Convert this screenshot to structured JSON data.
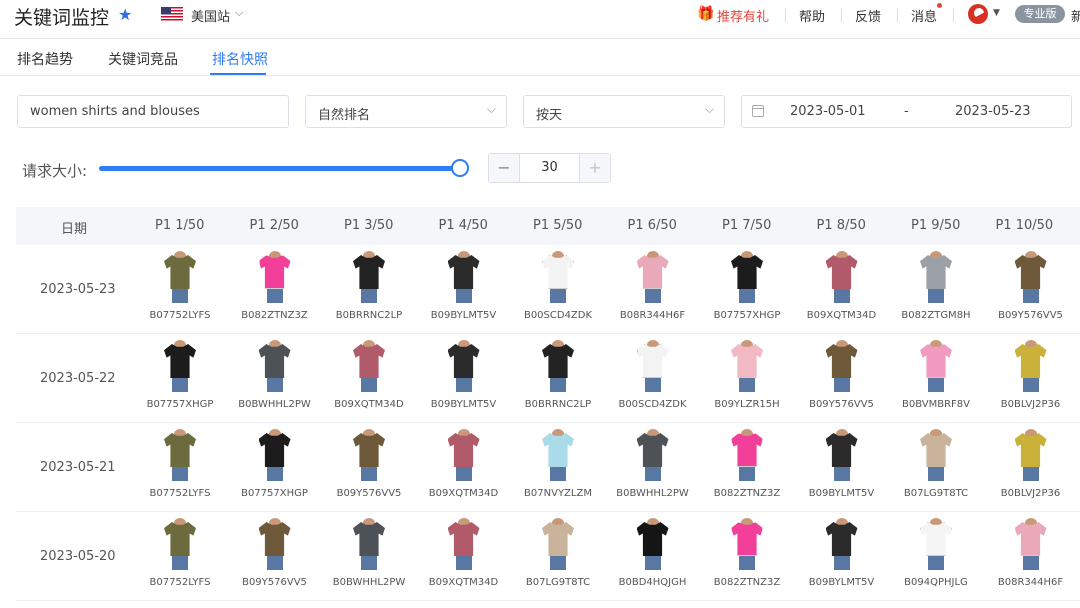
{
  "header": {
    "title": "关键词监控",
    "site": "美国站",
    "recommend": "推荐有礼",
    "help": "帮助",
    "feedback": "反馈",
    "messages": "消息",
    "plan": "专业版",
    "user_trunc": "新",
    "accent_color": "#2f7cf6",
    "alert_color": "#e2453c"
  },
  "tabs": [
    {
      "label": "排名趋势",
      "active": false
    },
    {
      "label": "关键词竞品",
      "active": false
    },
    {
      "label": "排名快照",
      "active": true
    }
  ],
  "filters": {
    "keyword": "women shirts and blouses",
    "rank_type": "自然排名",
    "granularity": "按天",
    "date_start": "2023-05-01",
    "date_sep": "-",
    "date_end": "2023-05-23"
  },
  "request_size": {
    "label": "请求大小:",
    "value": "30",
    "slider_fraction": 1.0
  },
  "table": {
    "date_header": "日期",
    "columns": [
      "P1 1/50",
      "P1 2/50",
      "P1 3/50",
      "P1 4/50",
      "P1 5/50",
      "P1 6/50",
      "P1 7/50",
      "P1 8/50",
      "P1 9/50",
      "P1 10/50"
    ],
    "rows": [
      {
        "date": "2023-05-23",
        "items": [
          {
            "asin": "B07752LYFS",
            "color": "#6b6b3d"
          },
          {
            "asin": "B082ZTNZ3Z",
            "color": "#f2409a"
          },
          {
            "asin": "B0BRRNC2LP",
            "color": "#222222"
          },
          {
            "asin": "B09BYLMT5V",
            "color": "#2b2b2b"
          },
          {
            "asin": "B00SCD4ZDK",
            "color": "#f3f3f3"
          },
          {
            "asin": "B08R344H6F",
            "color": "#e9a9b8"
          },
          {
            "asin": "B07757XHGP",
            "color": "#1c1c1c"
          },
          {
            "asin": "B09XQTM34D",
            "color": "#b05a6a"
          },
          {
            "asin": "B082ZTGM8H",
            "color": "#9aa0a6"
          },
          {
            "asin": "B09Y576VV5",
            "color": "#6e5a3a"
          }
        ]
      },
      {
        "date": "2023-05-22",
        "items": [
          {
            "asin": "B07757XHGP",
            "color": "#1c1c1c"
          },
          {
            "asin": "B0BWHHL2PW",
            "color": "#4d5257"
          },
          {
            "asin": "B09XQTM34D",
            "color": "#b05a6a"
          },
          {
            "asin": "B09BYLMT5V",
            "color": "#2b2b2b"
          },
          {
            "asin": "B0BRRNC2LP",
            "color": "#222222"
          },
          {
            "asin": "B00SCD4ZDK",
            "color": "#f3f3f3"
          },
          {
            "asin": "B09YLZR15H",
            "color": "#f2b9c4"
          },
          {
            "asin": "B09Y576VV5",
            "color": "#6e5a3a"
          },
          {
            "asin": "B0BVMBRF8V",
            "color": "#f39ac0"
          },
          {
            "asin": "B0BLVJ2P36",
            "color": "#c9b13a"
          }
        ]
      },
      {
        "date": "2023-05-21",
        "items": [
          {
            "asin": "B07752LYFS",
            "color": "#6b6b3d"
          },
          {
            "asin": "B07757XHGP",
            "color": "#1c1c1c"
          },
          {
            "asin": "B09Y576VV5",
            "color": "#6e5a3a"
          },
          {
            "asin": "B09XQTM34D",
            "color": "#b05a6a"
          },
          {
            "asin": "B07NVYZLZM",
            "color": "#a9dbe8"
          },
          {
            "asin": "B0BWHHL2PW",
            "color": "#4d5257"
          },
          {
            "asin": "B082ZTNZ3Z",
            "color": "#f2409a"
          },
          {
            "asin": "B09BYLMT5V",
            "color": "#2b2b2b"
          },
          {
            "asin": "B07LG9T8TC",
            "color": "#c9b39a"
          },
          {
            "asin": "B0BLVJ2P36",
            "color": "#c9b13a"
          }
        ]
      },
      {
        "date": "2023-05-20",
        "items": [
          {
            "asin": "B07752LYFS",
            "color": "#6b6b3d"
          },
          {
            "asin": "B09Y576VV5",
            "color": "#6e5a3a"
          },
          {
            "asin": "B0BWHHL2PW",
            "color": "#4d5257"
          },
          {
            "asin": "B09XQTM34D",
            "color": "#b05a6a"
          },
          {
            "asin": "B07LG9T8TC",
            "color": "#c9b39a"
          },
          {
            "asin": "B0BD4HQJGH",
            "color": "#151515"
          },
          {
            "asin": "B082ZTNZ3Z",
            "color": "#f2409a"
          },
          {
            "asin": "B09BYLMT5V",
            "color": "#2b2b2b"
          },
          {
            "asin": "B094QPHJLG",
            "color": "#f5f5f5"
          },
          {
            "asin": "B08R344H6F",
            "color": "#e9a9b8"
          }
        ]
      }
    ]
  }
}
